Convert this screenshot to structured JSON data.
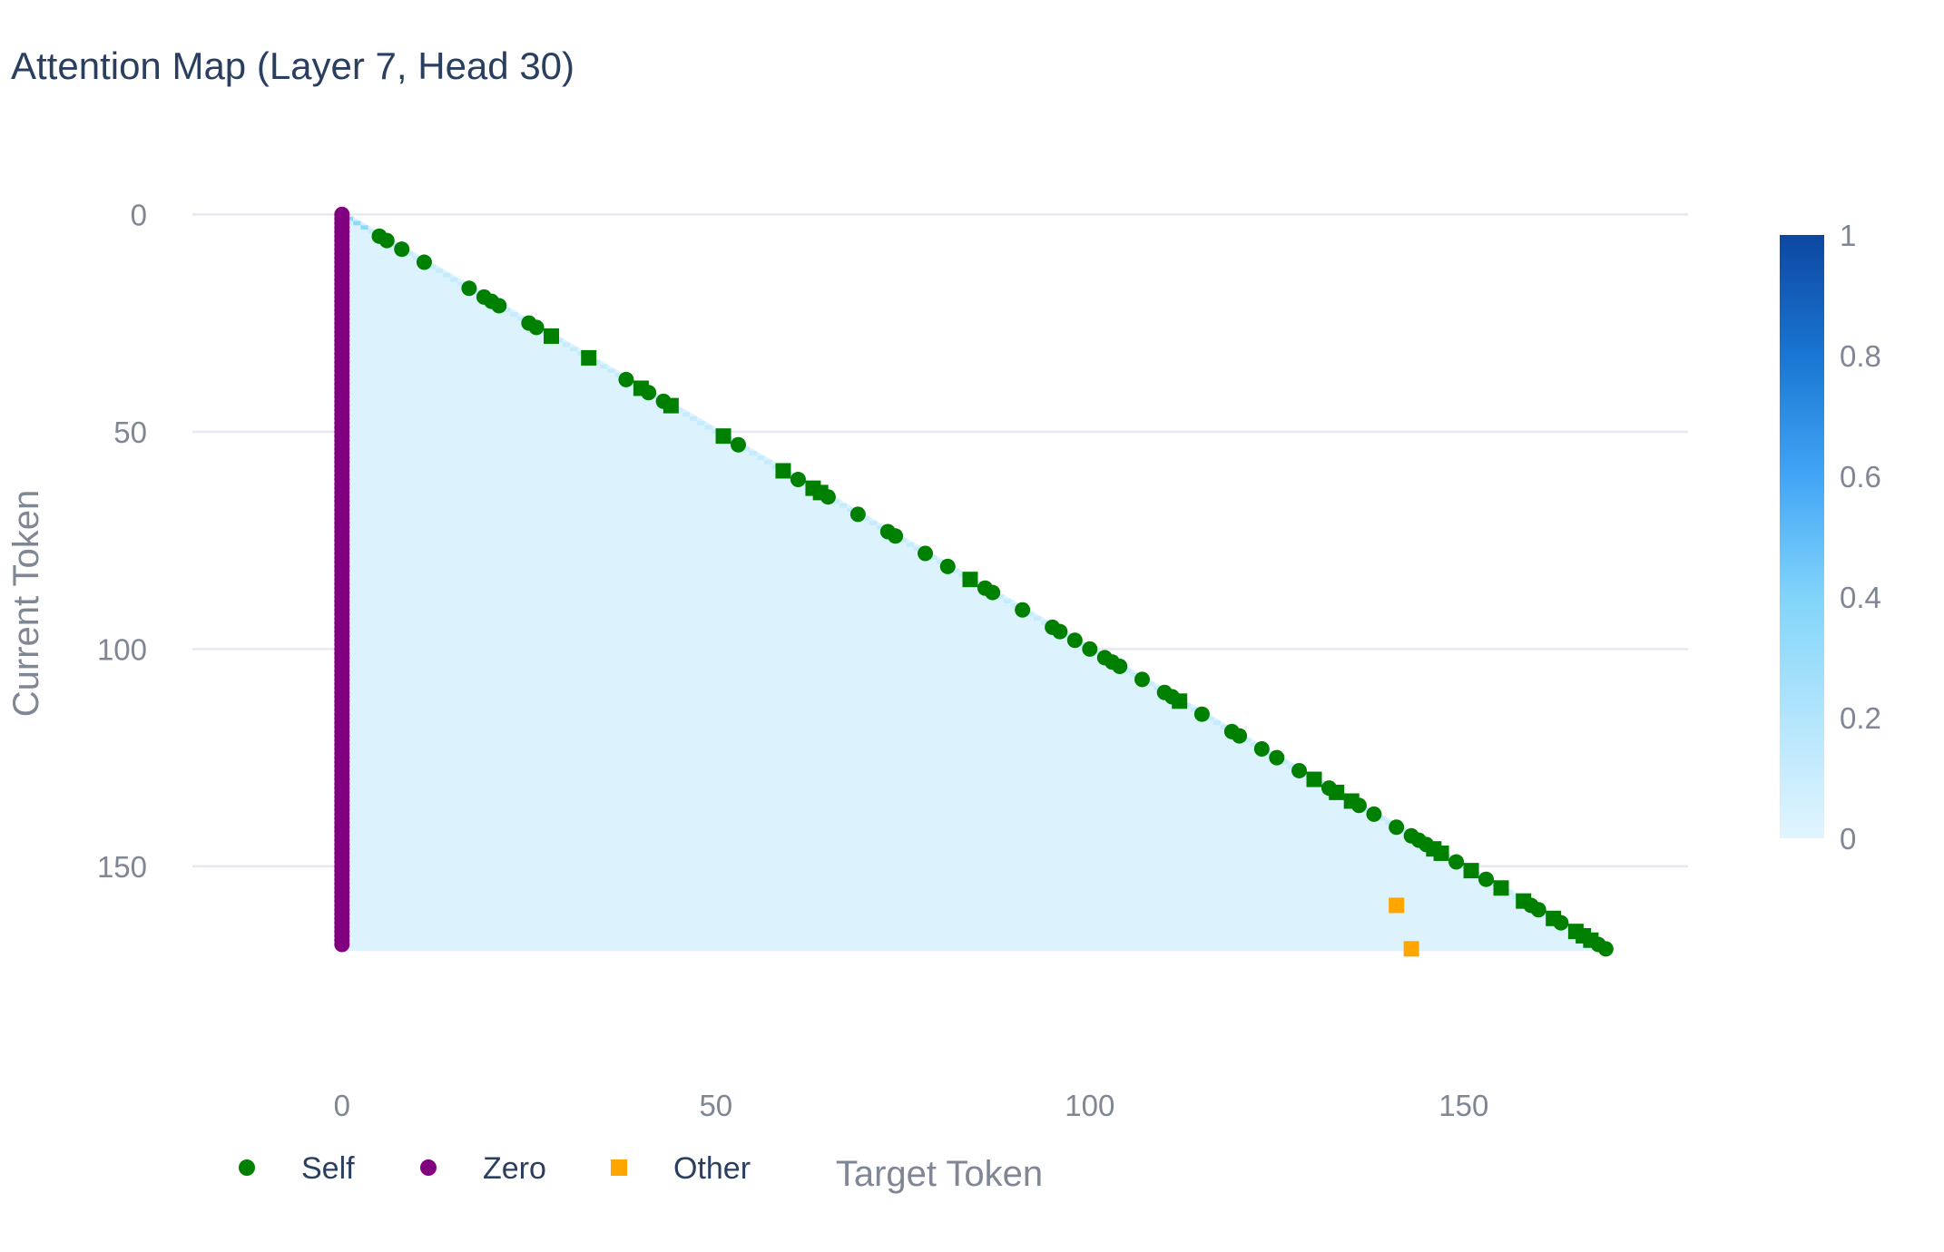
{
  "chart_data": {
    "type": "heatmap",
    "title": "Attention Map (Layer 7, Head 30)",
    "xlabel": "Target Token",
    "ylabel": "Current Token",
    "n_tokens": 170,
    "xlim": [
      -20,
      180
    ],
    "ylim": [
      192,
      -3
    ],
    "x_ticks": [
      0,
      50,
      100,
      150
    ],
    "y_ticks": [
      0,
      50,
      100,
      150
    ],
    "colorscale": {
      "range": [
        0,
        1
      ],
      "ticks": [
        0,
        0.2,
        0.4,
        0.6,
        0.8,
        1
      ],
      "colors": [
        "#e1f5fe",
        "#b3e5fc",
        "#81d4fa",
        "#42a5f5",
        "#1976d2",
        "#0d47a1"
      ]
    },
    "background_value": 0.02,
    "grid": true,
    "legend_position": "bottom-left",
    "series": [
      {
        "name": "Self",
        "color": "#008000",
        "marker": "circle",
        "points": [
          [
            5,
            5
          ],
          [
            6,
            6
          ],
          [
            8,
            8
          ],
          [
            11,
            11
          ],
          [
            17,
            17
          ],
          [
            19,
            19
          ],
          [
            20,
            20
          ],
          [
            21,
            21
          ],
          [
            25,
            25
          ],
          [
            26,
            26
          ],
          [
            38,
            38
          ],
          [
            41,
            41
          ],
          [
            43,
            43
          ],
          [
            53,
            53
          ],
          [
            61,
            61
          ],
          [
            65,
            65
          ],
          [
            69,
            69
          ],
          [
            73,
            73
          ],
          [
            74,
            74
          ],
          [
            78,
            78
          ],
          [
            81,
            81
          ],
          [
            86,
            86
          ],
          [
            87,
            87
          ],
          [
            91,
            91
          ],
          [
            95,
            95
          ],
          [
            96,
            96
          ],
          [
            98,
            98
          ],
          [
            100,
            100
          ],
          [
            102,
            102
          ],
          [
            103,
            103
          ],
          [
            104,
            104
          ],
          [
            107,
            107
          ],
          [
            110,
            110
          ],
          [
            111,
            111
          ],
          [
            115,
            115
          ],
          [
            119,
            119
          ],
          [
            120,
            120
          ],
          [
            123,
            123
          ],
          [
            125,
            125
          ],
          [
            128,
            128
          ],
          [
            132,
            132
          ],
          [
            136,
            136
          ],
          [
            138,
            138
          ],
          [
            141,
            141
          ],
          [
            143,
            143
          ],
          [
            144,
            144
          ],
          [
            145,
            145
          ],
          [
            149,
            149
          ],
          [
            153,
            153
          ],
          [
            159,
            159
          ],
          [
            160,
            160
          ],
          [
            163,
            163
          ],
          [
            168,
            168
          ],
          [
            169,
            169
          ]
        ]
      },
      {
        "name": "Self",
        "color": "#008000",
        "marker": "square",
        "points": [
          [
            28,
            28
          ],
          [
            33,
            33
          ],
          [
            40,
            40
          ],
          [
            44,
            44
          ],
          [
            51,
            51
          ],
          [
            59,
            59
          ],
          [
            63,
            63
          ],
          [
            64,
            64
          ],
          [
            84,
            84
          ],
          [
            112,
            112
          ],
          [
            130,
            130
          ],
          [
            133,
            133
          ],
          [
            135,
            135
          ],
          [
            146,
            146
          ],
          [
            147,
            147
          ],
          [
            151,
            151
          ],
          [
            155,
            155
          ],
          [
            158,
            158
          ],
          [
            162,
            162
          ],
          [
            165,
            165
          ],
          [
            166,
            166
          ],
          [
            167,
            167
          ]
        ]
      },
      {
        "name": "Zero",
        "color": "#800080",
        "marker": "circle",
        "points": [
          [
            0,
            0
          ],
          [
            0,
            1
          ],
          [
            0,
            2
          ],
          [
            0,
            3
          ],
          [
            0,
            4
          ],
          [
            0,
            5
          ],
          [
            0,
            6
          ],
          [
            0,
            7
          ],
          [
            0,
            8
          ],
          [
            0,
            9
          ],
          [
            0,
            10
          ],
          [
            0,
            11
          ],
          [
            0,
            12
          ],
          [
            0,
            13
          ],
          [
            0,
            14
          ],
          [
            0,
            15
          ],
          [
            0,
            16
          ],
          [
            0,
            17
          ],
          [
            0,
            18
          ],
          [
            0,
            19
          ],
          [
            0,
            20
          ],
          [
            0,
            21
          ],
          [
            0,
            22
          ],
          [
            0,
            23
          ],
          [
            0,
            24
          ],
          [
            0,
            25
          ],
          [
            0,
            26
          ],
          [
            0,
            27
          ],
          [
            0,
            28
          ],
          [
            0,
            29
          ],
          [
            0,
            30
          ],
          [
            0,
            31
          ],
          [
            0,
            32
          ],
          [
            0,
            33
          ],
          [
            0,
            34
          ],
          [
            0,
            35
          ],
          [
            0,
            36
          ],
          [
            0,
            37
          ],
          [
            0,
            38
          ],
          [
            0,
            39
          ],
          [
            0,
            40
          ],
          [
            0,
            41
          ],
          [
            0,
            42
          ],
          [
            0,
            43
          ],
          [
            0,
            44
          ],
          [
            0,
            45
          ],
          [
            0,
            46
          ],
          [
            0,
            47
          ],
          [
            0,
            48
          ],
          [
            0,
            49
          ],
          [
            0,
            50
          ],
          [
            0,
            51
          ],
          [
            0,
            52
          ],
          [
            0,
            53
          ],
          [
            0,
            54
          ],
          [
            0,
            55
          ],
          [
            0,
            56
          ],
          [
            0,
            57
          ],
          [
            0,
            58
          ],
          [
            0,
            59
          ],
          [
            0,
            60
          ],
          [
            0,
            61
          ],
          [
            0,
            62
          ],
          [
            0,
            63
          ],
          [
            0,
            64
          ],
          [
            0,
            65
          ],
          [
            0,
            66
          ],
          [
            0,
            67
          ],
          [
            0,
            68
          ],
          [
            0,
            69
          ],
          [
            0,
            70
          ],
          [
            0,
            71
          ],
          [
            0,
            72
          ],
          [
            0,
            73
          ],
          [
            0,
            74
          ],
          [
            0,
            75
          ],
          [
            0,
            76
          ],
          [
            0,
            77
          ],
          [
            0,
            78
          ],
          [
            0,
            79
          ],
          [
            0,
            80
          ],
          [
            0,
            81
          ],
          [
            0,
            82
          ],
          [
            0,
            83
          ],
          [
            0,
            84
          ],
          [
            0,
            85
          ],
          [
            0,
            86
          ],
          [
            0,
            87
          ],
          [
            0,
            88
          ],
          [
            0,
            89
          ],
          [
            0,
            90
          ],
          [
            0,
            91
          ],
          [
            0,
            92
          ],
          [
            0,
            93
          ],
          [
            0,
            94
          ],
          [
            0,
            95
          ],
          [
            0,
            96
          ],
          [
            0,
            97
          ],
          [
            0,
            98
          ],
          [
            0,
            99
          ],
          [
            0,
            100
          ],
          [
            0,
            101
          ],
          [
            0,
            102
          ],
          [
            0,
            103
          ],
          [
            0,
            104
          ],
          [
            0,
            105
          ],
          [
            0,
            106
          ],
          [
            0,
            107
          ],
          [
            0,
            108
          ],
          [
            0,
            109
          ],
          [
            0,
            110
          ],
          [
            0,
            111
          ],
          [
            0,
            112
          ],
          [
            0,
            113
          ],
          [
            0,
            114
          ],
          [
            0,
            115
          ],
          [
            0,
            116
          ],
          [
            0,
            117
          ],
          [
            0,
            118
          ],
          [
            0,
            119
          ],
          [
            0,
            120
          ],
          [
            0,
            121
          ],
          [
            0,
            122
          ],
          [
            0,
            123
          ],
          [
            0,
            124
          ],
          [
            0,
            125
          ],
          [
            0,
            126
          ],
          [
            0,
            127
          ],
          [
            0,
            128
          ],
          [
            0,
            129
          ],
          [
            0,
            130
          ],
          [
            0,
            131
          ],
          [
            0,
            132
          ],
          [
            0,
            133
          ],
          [
            0,
            134
          ],
          [
            0,
            135
          ],
          [
            0,
            136
          ],
          [
            0,
            137
          ],
          [
            0,
            138
          ],
          [
            0,
            139
          ],
          [
            0,
            140
          ],
          [
            0,
            141
          ],
          [
            0,
            142
          ],
          [
            0,
            143
          ],
          [
            0,
            144
          ],
          [
            0,
            145
          ],
          [
            0,
            146
          ],
          [
            0,
            147
          ],
          [
            0,
            148
          ],
          [
            0,
            149
          ],
          [
            0,
            150
          ],
          [
            0,
            151
          ],
          [
            0,
            152
          ],
          [
            0,
            153
          ],
          [
            0,
            154
          ],
          [
            0,
            155
          ],
          [
            0,
            156
          ],
          [
            0,
            157
          ],
          [
            0,
            158
          ],
          [
            0,
            159
          ],
          [
            0,
            160
          ],
          [
            0,
            161
          ],
          [
            0,
            162
          ],
          [
            0,
            163
          ],
          [
            0,
            164
          ],
          [
            0,
            165
          ],
          [
            0,
            166
          ],
          [
            0,
            167
          ],
          [
            0,
            168
          ]
        ]
      },
      {
        "name": "Other",
        "color": "#ffa500",
        "marker": "square",
        "points": [
          [
            141,
            159
          ],
          [
            143,
            169
          ]
        ]
      }
    ],
    "legend": [
      {
        "label": "Self",
        "color": "#008000",
        "marker": "circle"
      },
      {
        "label": "Zero",
        "color": "#800080",
        "marker": "circle"
      },
      {
        "label": "Other",
        "color": "#ffa500",
        "marker": "square"
      }
    ]
  }
}
